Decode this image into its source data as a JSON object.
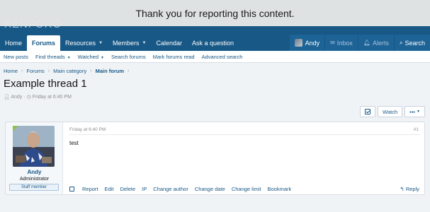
{
  "notice": {
    "text": "Thank you for reporting this content."
  },
  "site": {
    "logo_text": "XENFORO"
  },
  "nav": {
    "tabs": [
      {
        "label": "Home"
      },
      {
        "label": "Forums"
      },
      {
        "label": "Resources"
      },
      {
        "label": "Members"
      },
      {
        "label": "Calendar"
      },
      {
        "label": "Ask a question"
      }
    ],
    "user": "Andy",
    "inbox": "Inbox",
    "alerts": "Alerts",
    "search": "Search"
  },
  "subnav": {
    "items": [
      {
        "label": "New posts"
      },
      {
        "label": "Find threads"
      },
      {
        "label": "Watched"
      },
      {
        "label": "Search forums"
      },
      {
        "label": "Mark forums read"
      },
      {
        "label": "Advanced search"
      }
    ]
  },
  "breadcrumb": [
    "Home",
    "Forums",
    "Main category",
    "Main forum"
  ],
  "thread": {
    "title": "Example thread 1",
    "author": "Andy",
    "date": "Friday at 6:40 PM"
  },
  "watch": {
    "label": "Watch",
    "more": "•••"
  },
  "post": {
    "user": {
      "name": "Andy",
      "title": "Administrator",
      "banner": "Staff member"
    },
    "date": "Friday at 6:40 PM",
    "number": "#1",
    "body": "test",
    "actions": [
      "Report",
      "Edit",
      "Delete",
      "IP",
      "Change author",
      "Change date",
      "Change limit",
      "Bookmark"
    ],
    "reply": "Reply"
  },
  "colors": {
    "nav_bg": "#185886",
    "link": "#185886",
    "online": "#8cc152"
  },
  "icons": {
    "user": "user-icon",
    "clock": "clock-icon",
    "inbox": "inbox-icon",
    "alerts": "bell-icon",
    "search": "search-icon",
    "reply": "reply-icon"
  }
}
